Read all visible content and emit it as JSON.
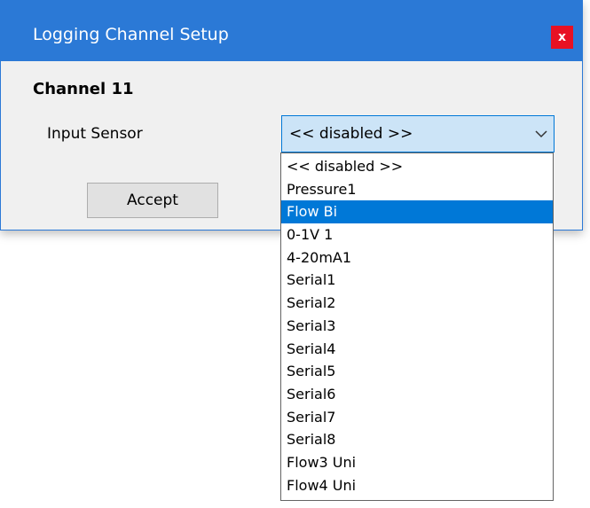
{
  "window": {
    "title": "Logging Channel Setup",
    "close_label": "x"
  },
  "form": {
    "channel_title": "Channel 11",
    "sensor_label": "Input Sensor",
    "selected_value": "<< disabled >>",
    "accept_label": "Accept"
  },
  "dropdown": {
    "highlighted_index": 2,
    "items": [
      "<< disabled >>",
      "Pressure1",
      "Flow Bi",
      "0-1V 1",
      "4-20mA1",
      "Serial1",
      "Serial2",
      "Serial3",
      "Serial4",
      "Serial5",
      "Serial6",
      "Serial7",
      "Serial8",
      "Flow3 Uni",
      "Flow4 Uni"
    ]
  },
  "colors": {
    "titlebar": "#2b79d6",
    "close_button": "#e81123",
    "highlight": "#0078d7",
    "combo_bg": "#cce4f7"
  },
  "icons": {
    "close": "close-icon",
    "combo_arrow": "chevron-down-icon"
  }
}
